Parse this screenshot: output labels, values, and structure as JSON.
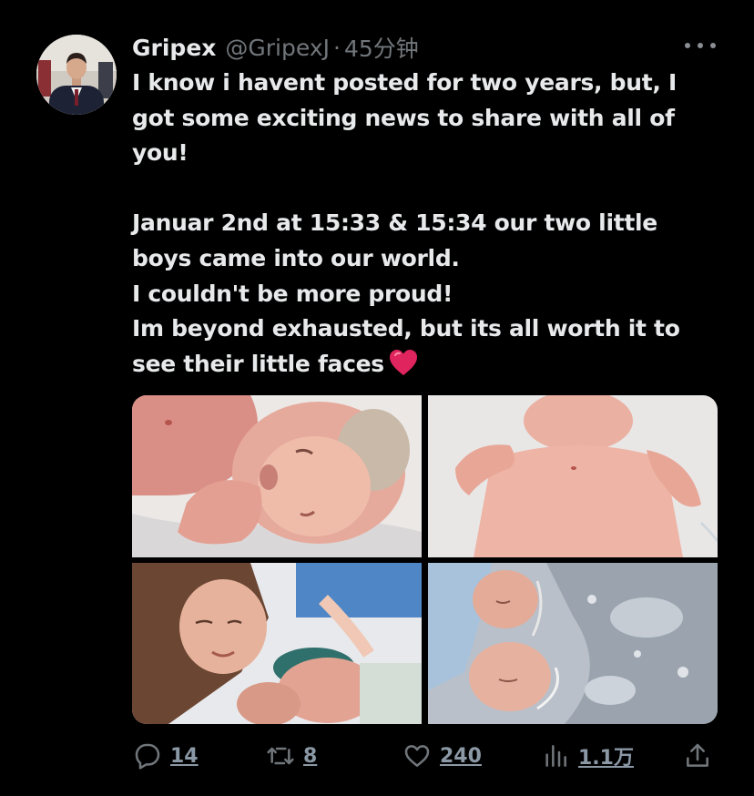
{
  "author": {
    "display_name": "Gripex",
    "handle": "@GripexJ",
    "separator": "·",
    "time": "45分钟"
  },
  "tweet": {
    "paragraphs": [
      {
        "lines": [
          "I know i havent posted for two years, but, I",
          "got some exciting news to share with all of",
          "you!"
        ]
      },
      {
        "lines": [
          "Januar 2nd at 15:33 & 15:34 our two little",
          "boys came into our world.",
          "I couldn't be more proud!",
          "Im beyond exhausted, but its all worth it to",
          "see their little faces"
        ]
      }
    ],
    "emoji": "heart-emoji"
  },
  "media": {
    "photos": [
      {
        "name": "photo-newborn-closeup"
      },
      {
        "name": "photo-newborn-chest"
      },
      {
        "name": "photo-mother-with-baby"
      },
      {
        "name": "photo-twins-sleeping"
      }
    ]
  },
  "actions": {
    "reply_count": "14",
    "retweet_count": "8",
    "like_count": "240",
    "views_count": "1.1万"
  },
  "colors": {
    "background": "#000000",
    "text_primary": "#e7e9ea",
    "text_secondary": "#71767b",
    "heart": "#e0245e"
  }
}
